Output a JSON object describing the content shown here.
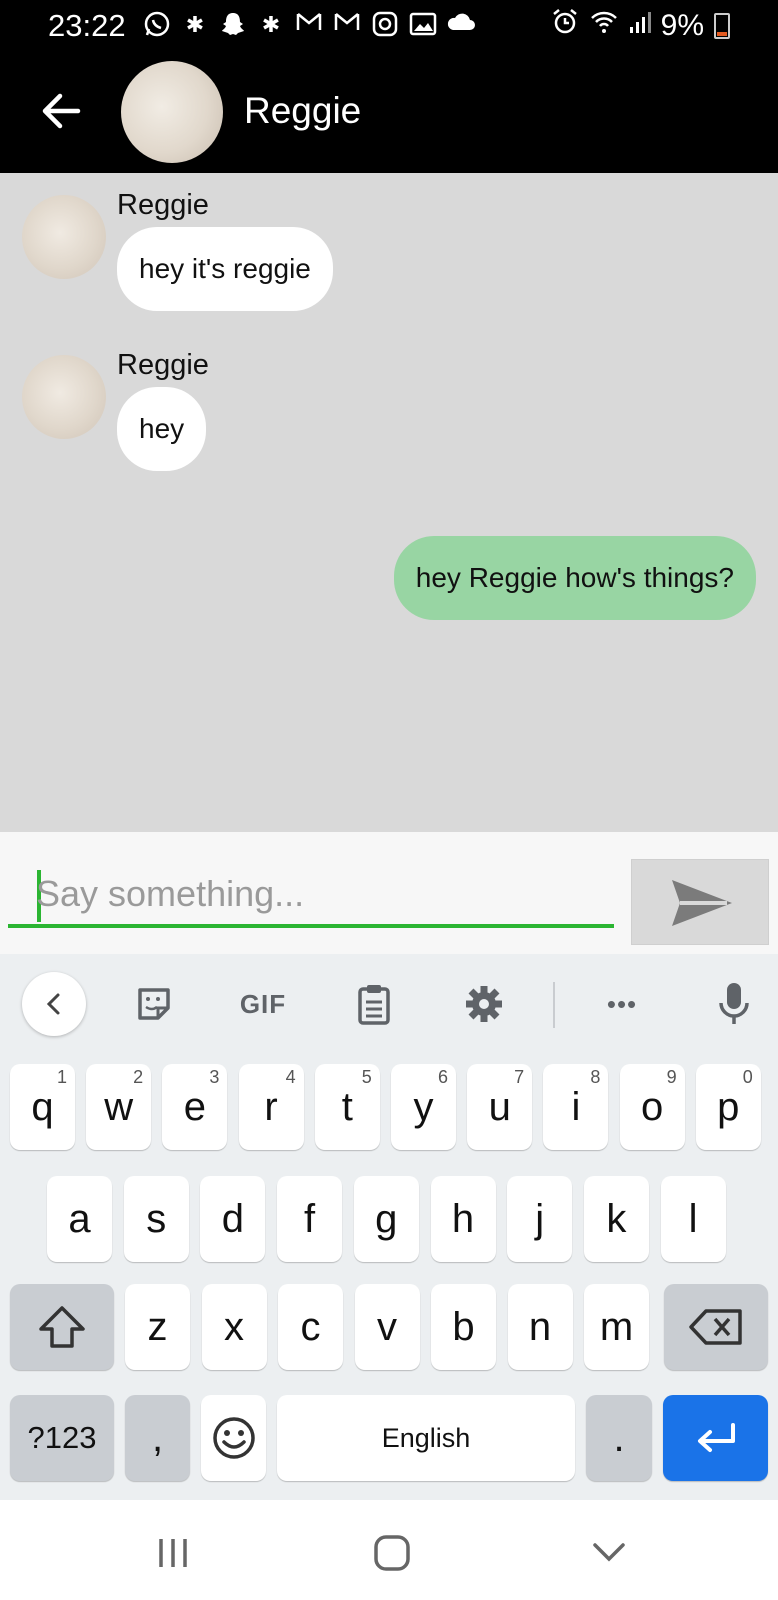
{
  "status_bar": {
    "time": "23:22",
    "battery": "9%",
    "notification_icons": [
      "whatsapp-icon",
      "slack-icon",
      "snapchat-icon",
      "slack-icon",
      "gmail-icon",
      "gmail-icon",
      "instagram-icon",
      "gallery-icon",
      "cloud-icon"
    ],
    "system_icons": [
      "alarm-icon",
      "wifi-icon",
      "signal-icon",
      "battery-icon"
    ]
  },
  "header": {
    "contact_name": "Reggie"
  },
  "messages": [
    {
      "direction": "incoming",
      "sender": "Reggie",
      "text": "hey it's reggie"
    },
    {
      "direction": "incoming",
      "sender": "Reggie",
      "text": "hey"
    },
    {
      "direction": "outgoing",
      "text": "hey Reggie how's things?"
    }
  ],
  "composer": {
    "placeholder": "Say something...",
    "value": ""
  },
  "keyboard": {
    "toolbar": {
      "gif_label": "GIF",
      "more_label": "•••"
    },
    "row1": [
      {
        "k": "q",
        "h": "1"
      },
      {
        "k": "w",
        "h": "2"
      },
      {
        "k": "e",
        "h": "3"
      },
      {
        "k": "r",
        "h": "4"
      },
      {
        "k": "t",
        "h": "5"
      },
      {
        "k": "y",
        "h": "6"
      },
      {
        "k": "u",
        "h": "7"
      },
      {
        "k": "i",
        "h": "8"
      },
      {
        "k": "o",
        "h": "9"
      },
      {
        "k": "p",
        "h": "0"
      }
    ],
    "row2": [
      "a",
      "s",
      "d",
      "f",
      "g",
      "h",
      "j",
      "k",
      "l"
    ],
    "row3": [
      "z",
      "x",
      "c",
      "v",
      "b",
      "n",
      "m"
    ],
    "row4": {
      "symbols": "?123",
      "comma": ",",
      "space": "English",
      "period": "."
    }
  },
  "colors": {
    "outgoing_bubble": "#98d5a3",
    "incoming_bubble": "#ffffff",
    "chat_background": "#d9d9d9",
    "input_underline": "#2bb532",
    "enter_key": "#1a73e8"
  }
}
